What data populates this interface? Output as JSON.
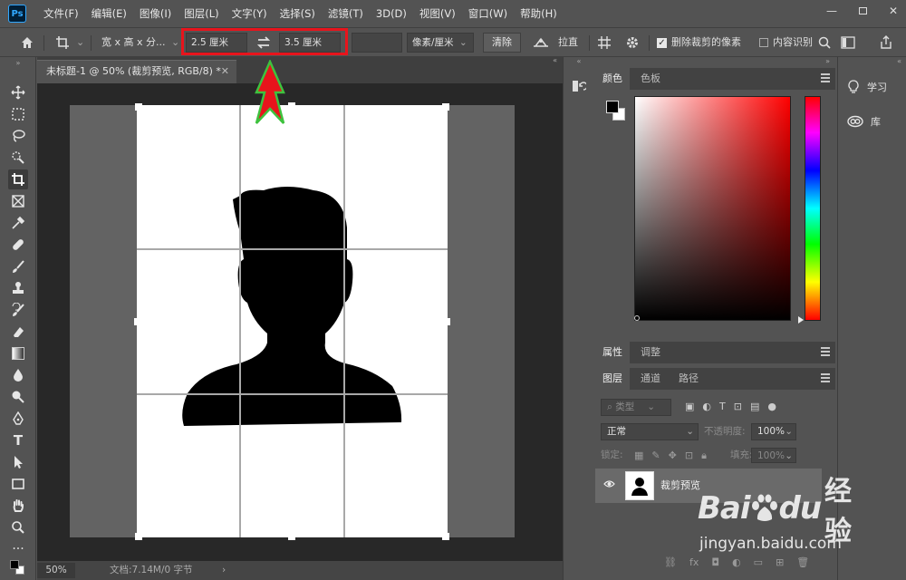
{
  "app": {
    "logo": "Ps"
  },
  "menu": [
    "文件(F)",
    "编辑(E)",
    "图像(I)",
    "图层(L)",
    "文字(Y)",
    "选择(S)",
    "滤镜(T)",
    "3D(D)",
    "视图(V)",
    "窗口(W)",
    "帮助(H)"
  ],
  "options": {
    "ratio_select": "宽 x 高 x 分...",
    "width_value": "2.5 厘米",
    "height_value": "3.5 厘米",
    "resolution_value": "",
    "unit_select": "像素/厘米",
    "clear_label": "清除",
    "straighten_label": "拉直",
    "delete_cropped_label": "删除裁剪的像素",
    "delete_cropped_checked": true,
    "content_aware_label": "内容识别",
    "content_aware_checked": false
  },
  "document": {
    "tab_title": "未标题-1 @ 50% (裁剪预览, RGB/8) *",
    "zoom": "50%",
    "doc_info": "文档:7.14M/0 字节"
  },
  "color_panel": {
    "tabs": [
      "颜色",
      "色板"
    ],
    "active_tab": "颜色",
    "foreground": "#000000",
    "background": "#ffffff"
  },
  "properties_panel": {
    "tabs": [
      "属性",
      "调整"
    ],
    "active_tab": "属性"
  },
  "layers_panel": {
    "tabs": [
      "图层",
      "通道",
      "路径"
    ],
    "active_tab": "图层",
    "filter_label": "类型",
    "blend_mode": "正常",
    "opacity_label": "不透明度:",
    "opacity_value": "100%",
    "lock_label": "锁定:",
    "fill_label": "填充:",
    "fill_value": "100%",
    "layers": [
      {
        "name": "裁剪预览",
        "visible": true
      }
    ]
  },
  "learn_panel": {
    "items": [
      "学习",
      "库"
    ]
  },
  "watermark": {
    "brand": "Bai",
    "brand_end": "du",
    "cn": "经验",
    "url": "jingyan.baidu.com"
  },
  "colors": {
    "highlight_box": "#e8141c",
    "arrow_fill": "#e8141c",
    "arrow_outline": "#3ec23e"
  }
}
